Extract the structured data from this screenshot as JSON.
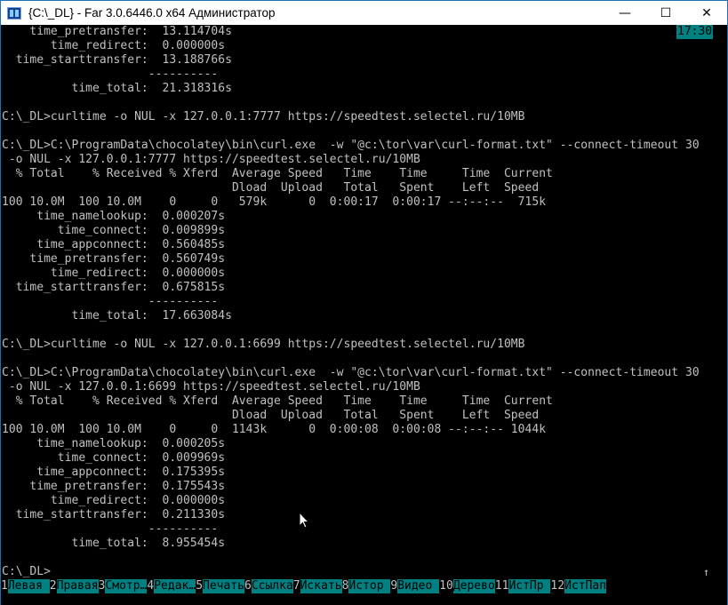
{
  "window": {
    "title": "{C:\\_DL} - Far 3.0.6446.0 x64 Администратор",
    "minimize": "—",
    "maximize": "☐",
    "close": "✕"
  },
  "clock": "17:30",
  "terminal_lines": [
    "    time_pretransfer:  13.114704s",
    "       time_redirect:  0.000000s",
    "  time_starttransfer:  13.188766s",
    "                     ----------",
    "          time_total:  21.318316s",
    "",
    "C:\\_DL>curltime -o NUL -x 127.0.0.1:7777 https://speedtest.selectel.ru/10MB",
    "",
    "C:\\_DL>C:\\ProgramData\\chocolatey\\bin\\curl.exe  -w \"@c:\\tor\\var\\curl-format.txt\" --connect-timeout 30",
    " -o NUL -x 127.0.0.1:7777 https://speedtest.selectel.ru/10MB",
    "  % Total    % Received % Xferd  Average Speed   Time    Time     Time  Current",
    "                                 Dload  Upload   Total   Spent    Left  Speed",
    "100 10.0M  100 10.0M    0     0   579k      0  0:00:17  0:00:17 --:--:--  715k",
    "     time_namelookup:  0.000207s",
    "        time_connect:  0.009899s",
    "     time_appconnect:  0.560485s",
    "    time_pretransfer:  0.560749s",
    "       time_redirect:  0.000000s",
    "  time_starttransfer:  0.675815s",
    "                     ----------",
    "          time_total:  17.663084s",
    "",
    "C:\\_DL>curltime -o NUL -x 127.0.0.1:6699 https://speedtest.selectel.ru/10MB",
    "",
    "C:\\_DL>C:\\ProgramData\\chocolatey\\bin\\curl.exe  -w \"@c:\\tor\\var\\curl-format.txt\" --connect-timeout 30",
    " -o NUL -x 127.0.0.1:6699 https://speedtest.selectel.ru/10MB",
    "  % Total    % Received % Xferd  Average Speed   Time    Time     Time  Current",
    "                                 Dload  Upload   Total   Spent    Left  Speed",
    "100 10.0M  100 10.0M    0     0  1143k      0  0:00:08  0:00:08 --:--:-- 1044k",
    "     time_namelookup:  0.000205s",
    "        time_connect:  0.009969s",
    "     time_appconnect:  0.175395s",
    "    time_pretransfer:  0.175543s",
    "       time_redirect:  0.000000s",
    "  time_starttransfer:  0.211330s",
    "                     ----------",
    "          time_total:  8.955454s",
    "",
    "C:\\_DL>"
  ],
  "scroll_arrow": "↑",
  "keybar": [
    {
      "num": "1",
      "label": "Левая "
    },
    {
      "num": "2",
      "label": "Правая"
    },
    {
      "num": "3",
      "label": "Смотр…"
    },
    {
      "num": "4",
      "label": "Редак…"
    },
    {
      "num": "5",
      "label": "Печать"
    },
    {
      "num": "6",
      "label": "Ссылка"
    },
    {
      "num": "7",
      "label": "Искать"
    },
    {
      "num": "8",
      "label": "Истор "
    },
    {
      "num": "9",
      "label": "Видео "
    },
    {
      "num": "10",
      "label": "Дерево"
    },
    {
      "num": "11",
      "label": "ИстПр "
    },
    {
      "num": "12",
      "label": "ИстПап"
    }
  ],
  "colors": {
    "terminal_bg": "#000000",
    "terminal_fg": "#c0c0c0",
    "keybar_label_bg": "#008080"
  }
}
